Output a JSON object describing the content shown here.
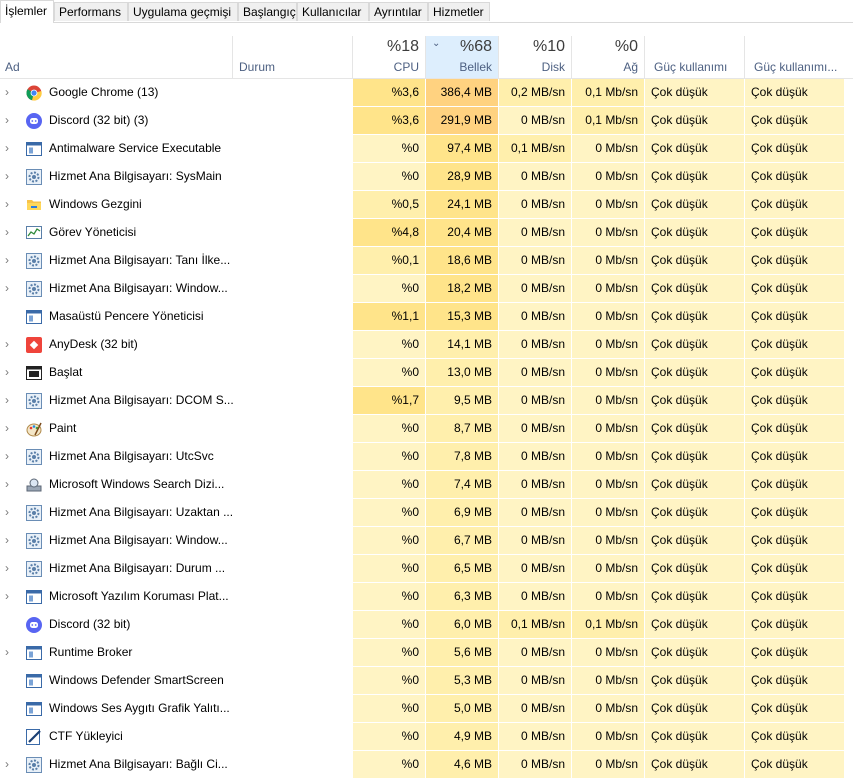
{
  "tabs": [
    "İşlemler",
    "Performans",
    "Uygulama geçmişi",
    "Başlangıç",
    "Kullanıcılar",
    "Ayrıntılar",
    "Hizmetler"
  ],
  "header": {
    "name_label": "Ad",
    "status_label": "Durum",
    "cpu_pct": "%18",
    "cpu_label": "CPU",
    "mem_pct": "%68",
    "mem_label": "Bellek",
    "disk_pct": "%10",
    "disk_label": "Disk",
    "net_pct": "%0",
    "net_label": "Ağ",
    "power_label": "Güç kullanımı",
    "power_trend_label": "Güç kullanımı..."
  },
  "colors": {
    "light": "#fff4c4",
    "mid": "#ffefac",
    "strong": "#ffe48a",
    "mem_top": "#ffd280",
    "sorted_header": "#ddeefd"
  },
  "rows": [
    {
      "name": "Google Chrome (13)",
      "icon": "chrome-icon",
      "expand": true,
      "cpu": "%3,6",
      "mem": "386,4 MB",
      "disk": "0,2 MB/sn",
      "net": "0,1 Mb/sn",
      "p1": "Çok düşük",
      "p2": "Çok düşük"
    },
    {
      "name": "Discord (32 bit) (3)",
      "icon": "discord-icon",
      "expand": true,
      "cpu": "%3,6",
      "mem": "291,9 MB",
      "disk": "0 MB/sn",
      "net": "0,1 Mb/sn",
      "p1": "Çok düşük",
      "p2": "Çok düşük"
    },
    {
      "name": "Antimalware Service Executable",
      "icon": "service-window-icon",
      "expand": true,
      "cpu": "%0",
      "mem": "97,4 MB",
      "disk": "0,1 MB/sn",
      "net": "0 Mb/sn",
      "p1": "Çok düşük",
      "p2": "Çok düşük"
    },
    {
      "name": "Hizmet Ana Bilgisayarı: SysMain",
      "icon": "gear-icon",
      "expand": true,
      "cpu": "%0",
      "mem": "28,9 MB",
      "disk": "0 MB/sn",
      "net": "0 Mb/sn",
      "p1": "Çok düşük",
      "p2": "Çok düşük"
    },
    {
      "name": "Windows Gezgini",
      "icon": "folder-icon",
      "expand": true,
      "cpu": "%0,5",
      "mem": "24,1 MB",
      "disk": "0 MB/sn",
      "net": "0 Mb/sn",
      "p1": "Çok düşük",
      "p2": "Çok düşük"
    },
    {
      "name": "Görev Yöneticisi",
      "icon": "task-manager-icon",
      "expand": true,
      "cpu": "%4,8",
      "mem": "20,4 MB",
      "disk": "0 MB/sn",
      "net": "0 Mb/sn",
      "p1": "Çok düşük",
      "p2": "Çok düşük"
    },
    {
      "name": "Hizmet Ana Bilgisayarı: Tanı İlke...",
      "icon": "gear-icon",
      "expand": true,
      "cpu": "%0,1",
      "mem": "18,6 MB",
      "disk": "0 MB/sn",
      "net": "0 Mb/sn",
      "p1": "Çok düşük",
      "p2": "Çok düşük"
    },
    {
      "name": "Hizmet Ana Bilgisayarı: Window...",
      "icon": "gear-icon",
      "expand": true,
      "cpu": "%0",
      "mem": "18,2 MB",
      "disk": "0 MB/sn",
      "net": "0 Mb/sn",
      "p1": "Çok düşük",
      "p2": "Çok düşük"
    },
    {
      "name": "Masaüstü Pencere Yöneticisi",
      "icon": "service-window-icon",
      "expand": false,
      "cpu": "%1,1",
      "mem": "15,3 MB",
      "disk": "0 MB/sn",
      "net": "0 Mb/sn",
      "p1": "Çok düşük",
      "p2": "Çok düşük"
    },
    {
      "name": "AnyDesk (32 bit)",
      "icon": "anydesk-icon",
      "expand": true,
      "cpu": "%0",
      "mem": "14,1 MB",
      "disk": "0 MB/sn",
      "net": "0 Mb/sn",
      "p1": "Çok düşük",
      "p2": "Çok düşük"
    },
    {
      "name": "Başlat",
      "icon": "start-icon",
      "expand": true,
      "cpu": "%0",
      "mem": "13,0 MB",
      "disk": "0 MB/sn",
      "net": "0 Mb/sn",
      "p1": "Çok düşük",
      "p2": "Çok düşük"
    },
    {
      "name": "Hizmet Ana Bilgisayarı: DCOM S...",
      "icon": "gear-icon",
      "expand": true,
      "cpu": "%1,7",
      "mem": "9,5 MB",
      "disk": "0 MB/sn",
      "net": "0 Mb/sn",
      "p1": "Çok düşük",
      "p2": "Çok düşük"
    },
    {
      "name": "Paint",
      "icon": "paint-icon",
      "expand": true,
      "cpu": "%0",
      "mem": "8,7 MB",
      "disk": "0 MB/sn",
      "net": "0 Mb/sn",
      "p1": "Çok düşük",
      "p2": "Çok düşük"
    },
    {
      "name": "Hizmet Ana Bilgisayarı: UtcSvc",
      "icon": "gear-icon",
      "expand": true,
      "cpu": "%0",
      "mem": "7,8 MB",
      "disk": "0 MB/sn",
      "net": "0 Mb/sn",
      "p1": "Çok düşük",
      "p2": "Çok düşük"
    },
    {
      "name": "Microsoft Windows Search Dizi...",
      "icon": "search-indexer-icon",
      "expand": true,
      "cpu": "%0",
      "mem": "7,4 MB",
      "disk": "0 MB/sn",
      "net": "0 Mb/sn",
      "p1": "Çok düşük",
      "p2": "Çok düşük"
    },
    {
      "name": "Hizmet Ana Bilgisayarı: Uzaktan ...",
      "icon": "gear-icon",
      "expand": true,
      "cpu": "%0",
      "mem": "6,9 MB",
      "disk": "0 MB/sn",
      "net": "0 Mb/sn",
      "p1": "Çok düşük",
      "p2": "Çok düşük"
    },
    {
      "name": "Hizmet Ana Bilgisayarı: Window...",
      "icon": "gear-icon",
      "expand": true,
      "cpu": "%0",
      "mem": "6,7 MB",
      "disk": "0 MB/sn",
      "net": "0 Mb/sn",
      "p1": "Çok düşük",
      "p2": "Çok düşük"
    },
    {
      "name": "Hizmet Ana Bilgisayarı: Durum ...",
      "icon": "gear-icon",
      "expand": true,
      "cpu": "%0",
      "mem": "6,5 MB",
      "disk": "0 MB/sn",
      "net": "0 Mb/sn",
      "p1": "Çok düşük",
      "p2": "Çok düşük"
    },
    {
      "name": "Microsoft Yazılım Koruması Plat...",
      "icon": "service-window-icon",
      "expand": true,
      "cpu": "%0",
      "mem": "6,3 MB",
      "disk": "0 MB/sn",
      "net": "0 Mb/sn",
      "p1": "Çok düşük",
      "p2": "Çok düşük"
    },
    {
      "name": "Discord (32 bit)",
      "icon": "discord-icon",
      "expand": false,
      "cpu": "%0",
      "mem": "6,0 MB",
      "disk": "0,1 MB/sn",
      "net": "0,1 Mb/sn",
      "p1": "Çok düşük",
      "p2": "Çok düşük"
    },
    {
      "name": "Runtime Broker",
      "icon": "service-window-icon",
      "expand": true,
      "cpu": "%0",
      "mem": "5,6 MB",
      "disk": "0 MB/sn",
      "net": "0 Mb/sn",
      "p1": "Çok düşük",
      "p2": "Çok düşük"
    },
    {
      "name": "Windows Defender SmartScreen",
      "icon": "service-window-icon",
      "expand": false,
      "cpu": "%0",
      "mem": "5,3 MB",
      "disk": "0 MB/sn",
      "net": "0 Mb/sn",
      "p1": "Çok düşük",
      "p2": "Çok düşük"
    },
    {
      "name": "Windows Ses Aygıtı Grafik Yalıtı...",
      "icon": "service-window-icon",
      "expand": false,
      "cpu": "%0",
      "mem": "5,0 MB",
      "disk": "0 MB/sn",
      "net": "0 Mb/sn",
      "p1": "Çok düşük",
      "p2": "Çok düşük"
    },
    {
      "name": "CTF Yükleyici",
      "icon": "ctf-pen-icon",
      "expand": false,
      "cpu": "%0",
      "mem": "4,9 MB",
      "disk": "0 MB/sn",
      "net": "0 Mb/sn",
      "p1": "Çok düşük",
      "p2": "Çok düşük"
    },
    {
      "name": "Hizmet Ana Bilgisayarı: Bağlı Ci...",
      "icon": "gear-icon",
      "expand": true,
      "cpu": "%0",
      "mem": "4,6 MB",
      "disk": "0 MB/sn",
      "net": "0 Mb/sn",
      "p1": "Çok düşük",
      "p2": "Çok düşük"
    }
  ]
}
